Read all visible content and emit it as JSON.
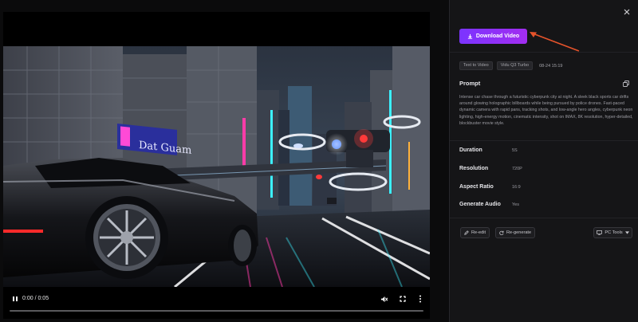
{
  "video": {
    "time": "0:00 / 0:05",
    "progress_fraction": 0.0,
    "play_state": "pause-icon",
    "controls": [
      "pause-icon",
      "mute-icon",
      "fullscreen-icon",
      "more-vertical-icon"
    ],
    "billboard_text": "Dat Guam"
  },
  "panel": {
    "download_label": "Download Video",
    "tags": [
      "Text to Video",
      "Vidu Q3 Turbo"
    ],
    "date": "08-24 15:19",
    "prompt_title": "Prompt",
    "prompt_text": "Intense car chase through a futuristic cyberpunk city at night. A sleek black sports car drifts around glowing holographic billboards while being pursued by police drones. Fast-paced dynamic camera with rapid pans, tracking shots, and low-angle hero angles, cyberpunk neon lighting, high-energy motion, cinematic intensity, shot on IMAX, 8K resolution, hyper-detailed, blockbuster movie style.",
    "specs": [
      {
        "label": "Duration",
        "value": "5S"
      },
      {
        "label": "Resolution",
        "value": "720P"
      },
      {
        "label": "Aspect Ratio",
        "value": "16:9"
      },
      {
        "label": "Generate Audio",
        "value": "Yes"
      }
    ],
    "re_edit_label": "Re-edit",
    "re_generate_label": "Re-generate",
    "pc_tools_label": "PC Tools"
  },
  "colors": {
    "accent_start": "#7b34ff",
    "accent_end": "#a22df0",
    "annotation_arrow": "#e5532b",
    "background": "#151517"
  }
}
